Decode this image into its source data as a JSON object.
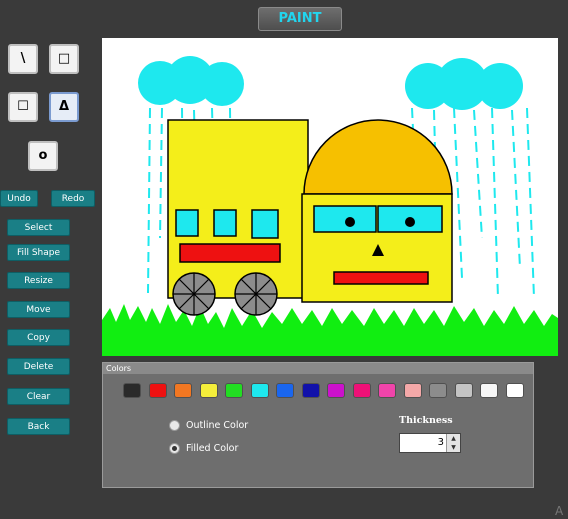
{
  "app": {
    "title": "PAINT"
  },
  "tools": [
    {
      "id": "line",
      "label": "\\",
      "selected": false
    },
    {
      "id": "square",
      "label": "□",
      "selected": false
    },
    {
      "id": "rectangle",
      "label": "☐",
      "selected": false
    },
    {
      "id": "triangle",
      "label": "Δ",
      "selected": true
    },
    {
      "id": "circle",
      "label": "o",
      "selected": false
    }
  ],
  "history": {
    "undo": "Undo",
    "redo": "Redo"
  },
  "actions": [
    "Select",
    "Fill Shape",
    "Resize",
    "Move",
    "Copy",
    "Delete",
    "Clear",
    "Back"
  ],
  "colors_panel": {
    "title": "Colors",
    "swatches": [
      "#2a2a2a",
      "#ee1111",
      "#f27722",
      "#f4ee3a",
      "#22dd22",
      "#1ee8ee",
      "#1a66ee",
      "#1111aa",
      "#cc11cc",
      "#ee1177",
      "#f044aa",
      "#f4a8a8",
      "#8c8c8c",
      "#c4c4c4",
      "#f6f6f6",
      "#ffffff"
    ],
    "outline_label": "Outline Color",
    "filled_label": "Filled Color",
    "selected_mode": "filled",
    "thickness_label": "Thickness",
    "thickness_value": "3"
  },
  "corner": {
    "glyph": "A"
  }
}
